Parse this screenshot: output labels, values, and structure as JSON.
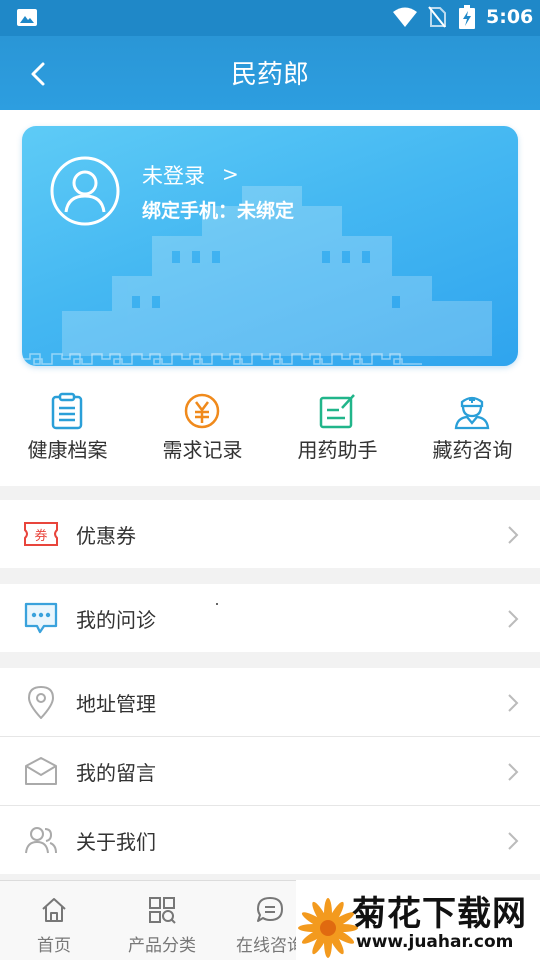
{
  "status_bar": {
    "time": "5:06"
  },
  "header": {
    "title": "民药郎"
  },
  "user_card": {
    "login_text": "未登录",
    "login_arrow": ">",
    "phone_label": "绑定手机：未绑定"
  },
  "quick_actions": [
    {
      "label": "健康档案",
      "icon": "clipboard-icon",
      "color": "#2a9fd8"
    },
    {
      "label": "需求记录",
      "icon": "yuan-coin-icon",
      "color": "#f08a1c"
    },
    {
      "label": "用药助手",
      "icon": "edit-note-icon",
      "color": "#21b58a"
    },
    {
      "label": "藏药咨询",
      "icon": "doctor-icon",
      "color": "#2a9fd8"
    }
  ],
  "menu": {
    "coupon": {
      "label": "优惠券",
      "badge": "券",
      "color": "#e8453c"
    },
    "consult": {
      "label": "我的问诊",
      "color": "#3aa2dc"
    },
    "address": {
      "label": "地址管理"
    },
    "messages": {
      "label": "我的留言"
    },
    "about": {
      "label": "关于我们"
    }
  },
  "bottom_nav": [
    {
      "label": "首页",
      "icon": "home-icon"
    },
    {
      "label": "产品分类",
      "icon": "grid-search-icon"
    },
    {
      "label": "在线咨询",
      "icon": "chat-icon"
    }
  ],
  "watermark": {
    "name": "菊花下载网",
    "url": "www.juahar.com"
  }
}
